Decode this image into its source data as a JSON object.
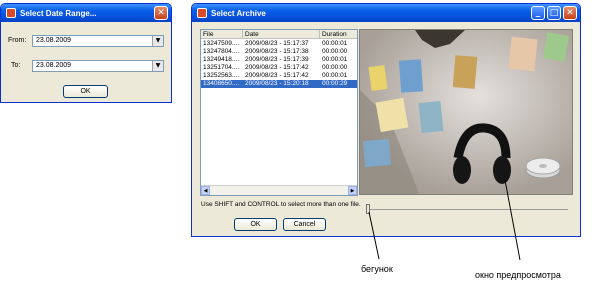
{
  "date_dialog": {
    "title": "Select Date Range...",
    "from_label": "From:",
    "from_value": "23.08.2009",
    "to_label": "To:",
    "to_value": "23.08.2009",
    "ok_label": "OK",
    "close_glyph": "✕"
  },
  "archive_dialog": {
    "title": "Select Archive",
    "min_glyph": "_",
    "max_glyph": "□",
    "close_glyph": "✕",
    "columns": [
      "File",
      "Date",
      "Duration"
    ],
    "rows": [
      {
        "file": "13247509....",
        "date": "2009/08/23 - 15:17:37",
        "duration": "00:00:01",
        "selected": false
      },
      {
        "file": "13247804....",
        "date": "2009/08/23 - 15:17:38",
        "duration": "00:00:00",
        "selected": false
      },
      {
        "file": "13249418....",
        "date": "2009/08/23 - 15:17:39",
        "duration": "00:00:01",
        "selected": false
      },
      {
        "file": "13251704....",
        "date": "2009/08/23 - 15:17:42",
        "duration": "00:00:00",
        "selected": false
      },
      {
        "file": "13252563....",
        "date": "2009/08/23 - 15:17:42",
        "duration": "00:00:01",
        "selected": false
      },
      {
        "file": "13408650....",
        "date": "2009/08/23 - 15:20:18",
        "duration": "00:00:29",
        "selected": true
      }
    ],
    "hint": "Use SHIFT and CONTROL to select more than one file.",
    "ok_label": "OK",
    "cancel_label": "Cancel",
    "slider_position": 0
  },
  "annotations": {
    "slider": "бегунок",
    "preview": "окно предпросмотра"
  },
  "colors": {
    "titlebar": "#0a5fe8",
    "selection": "#316ac5",
    "dialog_bg": "#ece9d8"
  }
}
